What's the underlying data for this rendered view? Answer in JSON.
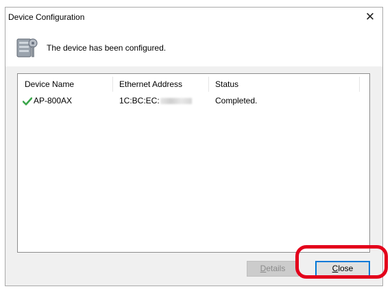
{
  "window": {
    "title": "Device Configuration",
    "close_glyph": "✕"
  },
  "header": {
    "message": "The device has been configured.",
    "icon": "device-config-icon"
  },
  "table": {
    "columns": [
      "Device Name",
      "Ethernet Address",
      "Status"
    ],
    "rows": [
      {
        "status_icon": "green-check-icon",
        "device_name": "AP-800AX",
        "ethernet_address": "1C:BC:EC:",
        "status": "Completed."
      }
    ]
  },
  "buttons": {
    "details": {
      "mnemonic": "D",
      "rest": "etails",
      "enabled": false
    },
    "close": {
      "mnemonic": "C",
      "rest": "lose",
      "enabled": true
    }
  },
  "annotation": {
    "highlight_color": "#e3001b",
    "target": "close-button"
  },
  "colors": {
    "dialog_bg": "#f0f0f0",
    "focus_border": "#0078d7",
    "check_green": "#3aa54a"
  }
}
